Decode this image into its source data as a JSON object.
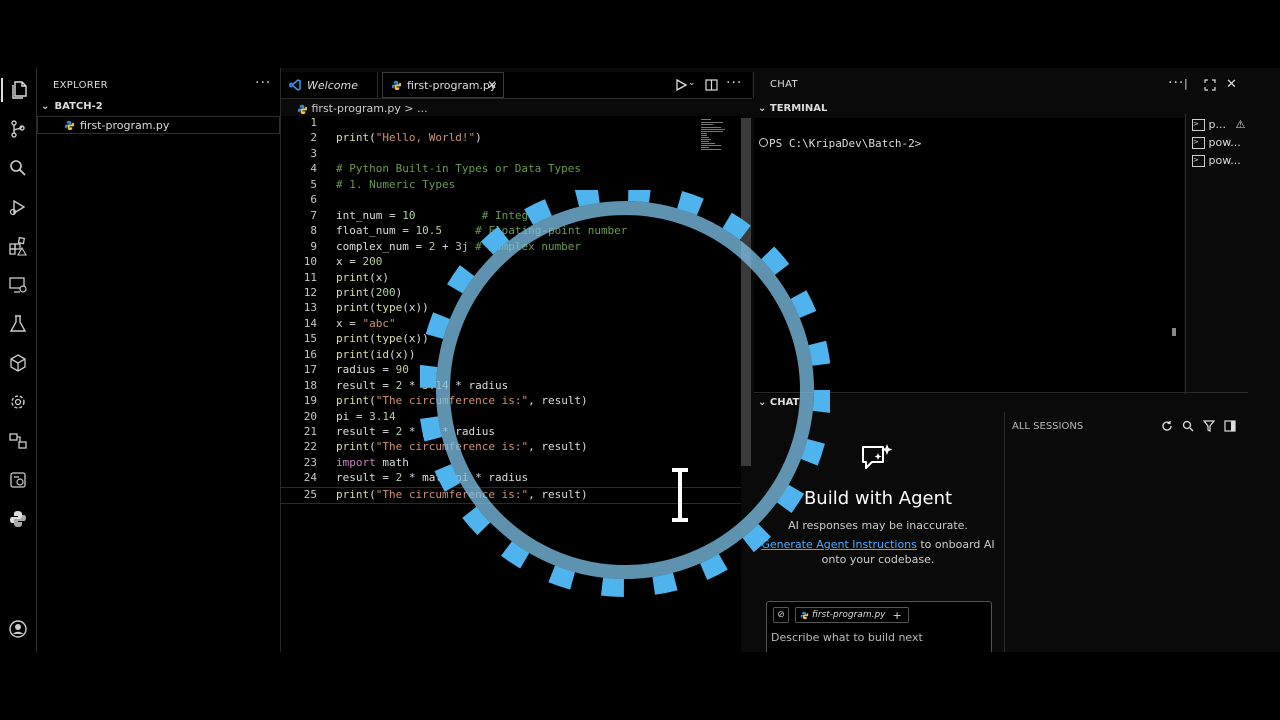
{
  "explorer": {
    "title": "EXPLORER",
    "more": "···",
    "folder": "BATCH-2",
    "file": "first-program.py"
  },
  "editor": {
    "tabs": [
      {
        "label": "Welcome"
      },
      {
        "label": "first-program.py",
        "close": "✕"
      }
    ],
    "breadcrumb_file": "first-program.py",
    "breadcrumb_sep": ">",
    "breadcrumb_more": "...",
    "actions_more": "···",
    "lines": [
      {
        "n": "1",
        "html": ""
      },
      {
        "n": "2",
        "html": "<span class='fn'>print</span>(<span class='str'>\"Hello, World!\"</span>)"
      },
      {
        "n": "3",
        "html": ""
      },
      {
        "n": "4",
        "html": "<span class='cmt'># Python Built-in Types or Data Types</span>"
      },
      {
        "n": "5",
        "html": "<span class='cmt'># 1. Numeric Types</span>"
      },
      {
        "n": "6",
        "html": ""
      },
      {
        "n": "7",
        "html": "int_num = <span class='num'>10</span>          <span class='cmt'># Integer</span>"
      },
      {
        "n": "8",
        "html": "float_num = <span class='num'>10.5</span>     <span class='cmt'># Floating-point number</span>"
      },
      {
        "n": "9",
        "html": "complex_num = <span class='num'>2</span> + <span class='num'>3j</span> <span class='cmt'># Complex number</span>"
      },
      {
        "n": "10",
        "html": "x = <span class='num'>200</span>"
      },
      {
        "n": "11",
        "html": "<span class='fn'>print</span>(x)"
      },
      {
        "n": "12",
        "html": "<span class='fn'>print</span>(<span class='num'>200</span>)"
      },
      {
        "n": "13",
        "html": "<span class='fn'>print</span>(<span class='fn'>type</span>(x))"
      },
      {
        "n": "14",
        "html": "x = <span class='str'>\"abc\"</span>"
      },
      {
        "n": "15",
        "html": "<span class='fn'>print</span>(<span class='fn'>type</span>(x))"
      },
      {
        "n": "16",
        "html": "<span class='fn'>print</span>(<span class='fn'>id</span>(x))"
      },
      {
        "n": "17",
        "html": "radius = <span class='num'>90</span>"
      },
      {
        "n": "18",
        "html": "result = <span class='num'>2</span> * <span class='num'>3.14</span> * radius"
      },
      {
        "n": "19",
        "html": "<span class='fn'>print</span>(<span class='str'>\"The circumference is:\"</span>, result)"
      },
      {
        "n": "20",
        "html": "pi = <span class='num'>3.14</span>"
      },
      {
        "n": "21",
        "html": "result = <span class='num'>2</span> * pi * radius"
      },
      {
        "n": "22",
        "html": "<span class='fn'>print</span>(<span class='str'>\"The circumference is:\"</span>, result)"
      },
      {
        "n": "23",
        "html": "<span class='kw'>import</span> math"
      },
      {
        "n": "24",
        "html": "result = <span class='num'>2</span> * math.pi * radius"
      },
      {
        "n": "25",
        "html": "<span class='fn'>print</span>(<span class='str'>\"The circumference is:\"</span>, result)"
      }
    ]
  },
  "chat_bar": {
    "label": "CHAT",
    "more": "···",
    "close": "✕"
  },
  "terminal": {
    "header": "TERMINAL",
    "prompt": "PS C:\\KripaDev\\Batch-2>",
    "sessions": [
      "p...",
      "pow...",
      "pow..."
    ]
  },
  "chat": {
    "header": "CHAT",
    "all_sessions": "ALL SESSIONS",
    "title": "Build with Agent",
    "disclaimer": "AI responses may be inaccurate.",
    "link": "Generate Agent Instructions",
    "link_rest": " to onboard AI",
    "line3": "onto your codebase.",
    "chip": "first-program.py",
    "chip_add": "+",
    "placeholder": "Describe what to build next"
  }
}
